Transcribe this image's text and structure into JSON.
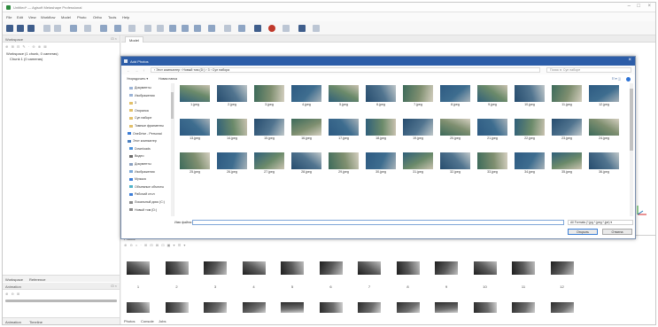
{
  "app": {
    "title": "Untitled* — Agisoft Metashape Professional",
    "menu": [
      "File",
      "Edit",
      "View",
      "Workflow",
      "Model",
      "Photo",
      "Ortho",
      "Tools",
      "Help"
    ],
    "window_controls": [
      "–",
      "□",
      "×"
    ]
  },
  "workspace": {
    "header": "Workspace",
    "header_controls": "⊡ ×",
    "tools": "⊕ ⊞ ⊟ ✎ · ⊖ ⊗ ⊠",
    "items": [
      "Workspace (1 chunk, 0 cameras)",
      "Chunk 1 (0 cameras)"
    ],
    "bottom_tabs": [
      "Workspace",
      "Reference"
    ]
  },
  "animation": {
    "header": "Animation",
    "header_controls": "⊡ ×",
    "tools": "⊕ ⊖ ⊞",
    "bottom_tabs": [
      "Animation",
      "Timeline"
    ]
  },
  "model": {
    "tab": "Model"
  },
  "photos": {
    "title": "Photos",
    "tools": "⊕ ⊖ × · ⊞ ⊟ ⊠ ⊡ ▣ ▾ ☰ ▾",
    "numbers": [
      "1",
      "2",
      "3",
      "4",
      "5",
      "6",
      "7",
      "8",
      "9",
      "10",
      "11",
      "12"
    ],
    "bottom_tabs": [
      "Photos",
      "Console",
      "Jobs"
    ]
  },
  "dialog": {
    "title": "Add Photos",
    "close": "×",
    "nav": "← → ↑",
    "path": "› Этот компьютер › Новый том (D:) › 3 › Суп набора",
    "search_placeholder": "Поиск в: Суп наборе",
    "organize": "Упорядочить ▾",
    "new_folder": "Новая папка",
    "view_controls": "☷ ▾  ◫",
    "nav_items": [
      "Документы",
      "Изображения",
      "3",
      "Огоралка",
      "Суп наборе",
      "Томные фрагменты",
      "OneDrive - Personal",
      "Этот компьютер",
      "Downloads",
      "Видео",
      "Документы",
      "Изображения",
      "Музыка",
      "Объемные объекты",
      "Рабочий стол",
      "Локальный диск (C:)",
      "Новый том (D:)"
    ],
    "files": [
      "1.jpeg",
      "2.jpeg",
      "3.jpeg",
      "4.jpeg",
      "5.jpeg",
      "6.jpeg",
      "7.jpeg",
      "8.jpeg",
      "9.jpeg",
      "10.jpeg",
      "11.jpeg",
      "12.jpeg",
      "13.jpeg",
      "14.jpeg",
      "15.jpeg",
      "16.jpeg",
      "17.jpeg",
      "18.jpeg",
      "19.jpeg",
      "20.jpeg",
      "21.jpeg",
      "22.jpeg",
      "23.jpeg",
      "24.jpeg",
      "25.jpeg",
      "26.jpeg",
      "27.jpeg",
      "28.jpeg",
      "29.jpeg",
      "30.jpeg",
      "31.jpeg",
      "32.jpeg",
      "33.jpeg",
      "34.jpeg",
      "35.jpeg",
      "36.jpeg"
    ],
    "filename_label": "Имя файла:",
    "filename_value": "",
    "filter_value": "All Formats (*.jpg *.jpeg *.jpe) ▾",
    "open_button": "Открыть",
    "cancel_button": "Отмена"
  },
  "colors": {
    "dialog_title": "#2c5da8",
    "accent": "#3c7fd6"
  }
}
